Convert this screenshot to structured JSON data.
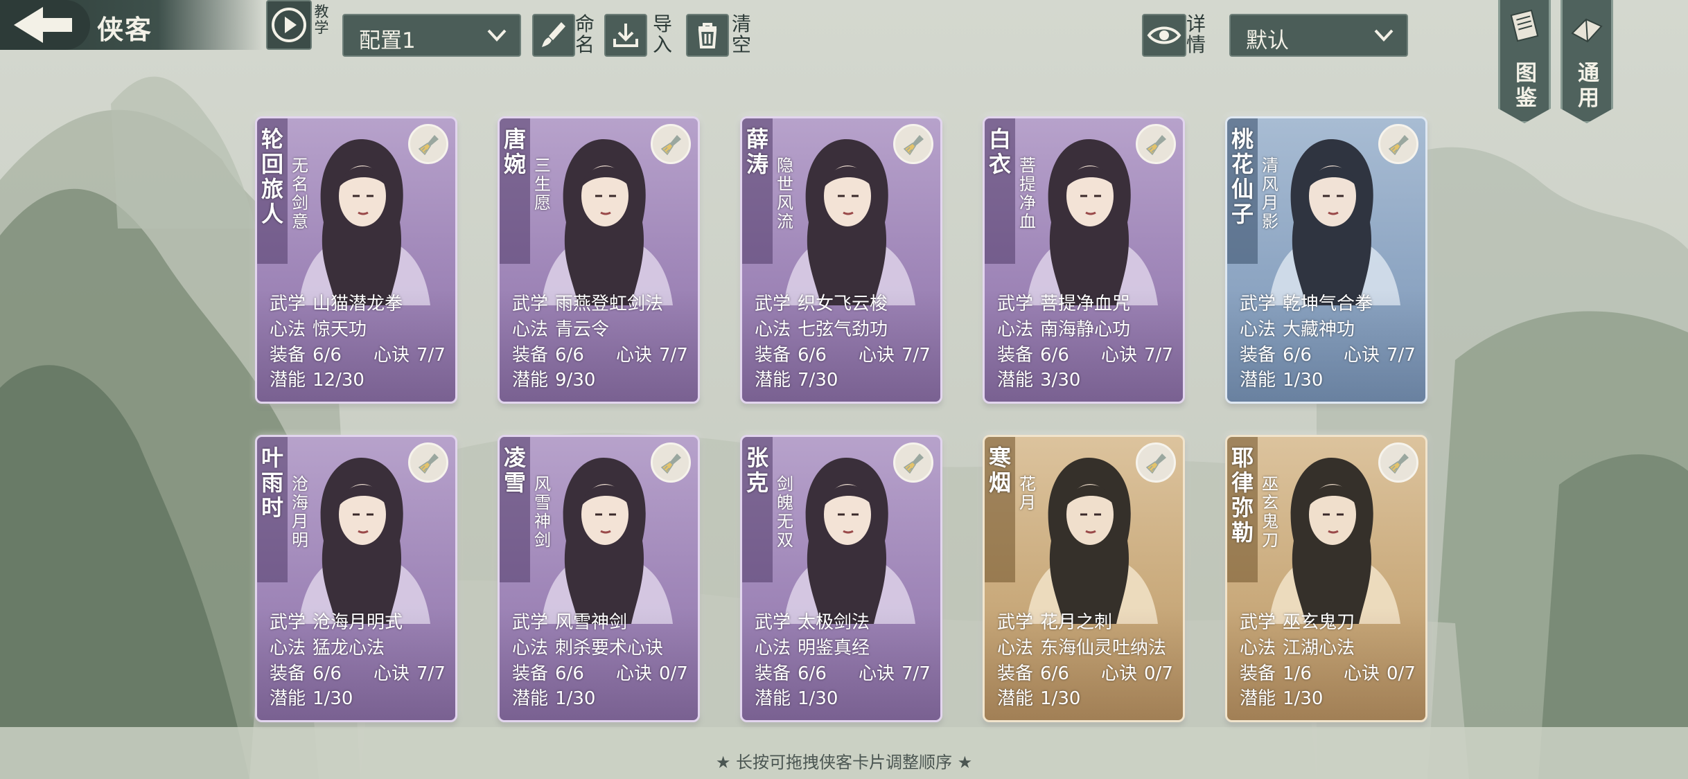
{
  "header": {
    "title": "侠客",
    "tutorial_label": "教学",
    "config_select": "配置1",
    "rename_label": "命名",
    "import_label": "导入",
    "clear_label": "清空",
    "detail_label": "详情",
    "sort_select": "默认",
    "codex_label": "图鉴",
    "general_label": "通用"
  },
  "stat_labels": {
    "martial": "武学",
    "mind": "心法",
    "equip": "装备",
    "secret": "心诀",
    "potential": "潜能"
  },
  "cards": [
    {
      "name": "轮回旅人",
      "epithet": "无名剑意",
      "martial": "山猫潜龙拳",
      "mind": "惊天功",
      "equip": "6/6",
      "secret": "7/7",
      "potential": "12/30",
      "theme": "purple"
    },
    {
      "name": "唐婉",
      "epithet": "三生愿",
      "martial": "雨燕登虹剑法",
      "mind": "青云令",
      "equip": "6/6",
      "secret": "7/7",
      "potential": "9/30",
      "theme": "purple"
    },
    {
      "name": "薛涛",
      "epithet": "隐世风流",
      "martial": "织女飞云梭",
      "mind": "七弦气劲功",
      "equip": "6/6",
      "secret": "7/7",
      "potential": "7/30",
      "theme": "purple"
    },
    {
      "name": "白衣",
      "epithet": "菩提净血",
      "martial": "菩提净血咒",
      "mind": "南海静心功",
      "equip": "6/6",
      "secret": "7/7",
      "potential": "3/30",
      "theme": "purple"
    },
    {
      "name": "桃花仙子",
      "epithet": "清风月影",
      "martial": "乾坤气合拳",
      "mind": "大藏神功",
      "equip": "6/6",
      "secret": "7/7",
      "potential": "1/30",
      "theme": "blue"
    },
    {
      "name": "叶雨时",
      "epithet": "沧海月明",
      "martial": "沧海月明式",
      "mind": "猛龙心法",
      "equip": "6/6",
      "secret": "7/7",
      "potential": "1/30",
      "theme": "purple"
    },
    {
      "name": "凌雪",
      "epithet": "风雪神剑",
      "martial": "风雪神剑",
      "mind": "刺杀要术心诀",
      "equip": "6/6",
      "secret": "0/7",
      "potential": "1/30",
      "theme": "purple"
    },
    {
      "name": "张克",
      "epithet": "剑魄无双",
      "martial": "太极剑法",
      "mind": "明鉴真经",
      "equip": "6/6",
      "secret": "7/7",
      "potential": "1/30",
      "theme": "purple"
    },
    {
      "name": "寒烟",
      "epithet": "花月",
      "martial": "花月之刺",
      "mind": "东海仙灵吐纳法",
      "equip": "6/6",
      "secret": "0/7",
      "potential": "1/30",
      "theme": "gold"
    },
    {
      "name": "耶律弥勒",
      "epithet": "巫玄鬼刀",
      "martial": "巫玄鬼刀",
      "mind": "江湖心法",
      "equip": "1/6",
      "secret": "0/7",
      "potential": "1/30",
      "theme": "gold"
    }
  ],
  "footer_hint": "★ 长按可拖拽侠客卡片调整顺序 ★"
}
